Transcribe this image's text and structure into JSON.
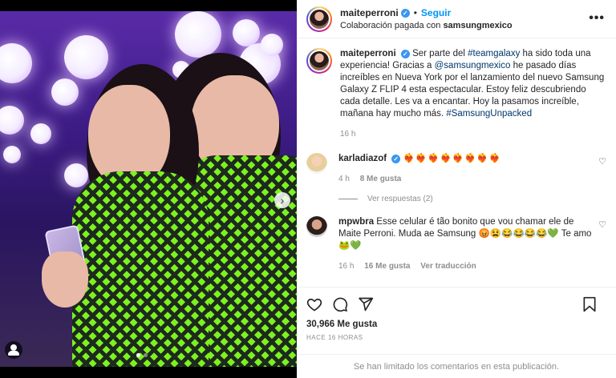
{
  "post": {
    "username": "maiteperroni",
    "follow_label": "Seguir",
    "separator": "•",
    "paid_partnership_prefix": "Colaboración pagada con",
    "partner": "samsungmexico",
    "more_label": "•••"
  },
  "caption": {
    "username": "maiteperroni",
    "parts": [
      "Ser parte del ",
      "#teamgalaxy",
      " ha sido toda una experiencia! Gracias a ",
      "@samsungmexico",
      " he pasado días increíbles en Nueva York por el lanzamiento del nuevo Samsung Galaxy Z FLIP 4 esta espectacular. Estoy feliz descubriendo cada detalle. Les va a encantar. Hoy la pasamos increíble, mañana hay mucho más. ",
      "#SamsungUnpacked"
    ],
    "time": "16 h"
  },
  "comments": [
    {
      "username": "karladiazof",
      "text": "❤️‍🔥❤️‍🔥❤️‍🔥❤️‍🔥❤️‍🔥❤️‍🔥❤️‍🔥❤️‍🔥",
      "time": "4 h",
      "likes": "8 Me gusta",
      "view_replies": "Ver respuestas (2)"
    },
    {
      "username": "mpwbra",
      "text": "Esse celular é tão bonito que vou chamar ele de Maite Perroni. Muda ae Samsung 😡😫😂😂😂😂💚 Te amo 🐸💚",
      "time": "16 h",
      "likes": "16 Me gusta",
      "translate": "Ver traducción"
    }
  ],
  "footer": {
    "likes": "30,966 Me gusta",
    "ago": "HACE 16 HORAS",
    "comments_limited": "Se han limitado los comentarios en esta publicación."
  },
  "colors": {
    "follow": "#0095f6",
    "verified": "#3897f0",
    "muted": "#8e8e8e"
  }
}
